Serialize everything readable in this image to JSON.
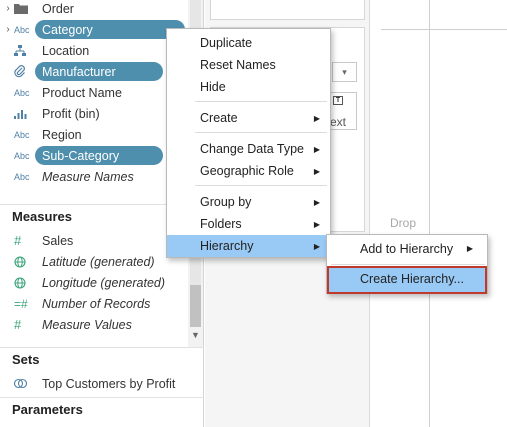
{
  "dimensions": {
    "items": [
      {
        "label": "Order",
        "icon": "folder-icon",
        "chevron": "›",
        "selected": false,
        "italic": false
      },
      {
        "label": "Category",
        "icon": "abc-icon",
        "chevron": "›",
        "selected": true,
        "italic": false
      },
      {
        "label": "Location",
        "icon": "hierarchy-icon",
        "chevron": "",
        "selected": false,
        "italic": false
      },
      {
        "label": "Manufacturer",
        "icon": "paperclip-icon",
        "chevron": "",
        "selected": true,
        "italic": false
      },
      {
        "label": "Product Name",
        "icon": "abc-icon",
        "chevron": "",
        "selected": false,
        "italic": false
      },
      {
        "label": "Profit (bin)",
        "icon": "histogram-icon",
        "chevron": "",
        "selected": false,
        "italic": false
      },
      {
        "label": "Region",
        "icon": "abc-icon",
        "chevron": "",
        "selected": false,
        "italic": false
      },
      {
        "label": "Sub-Category",
        "icon": "abc-icon",
        "chevron": "",
        "selected": true,
        "italic": false
      },
      {
        "label": "Measure Names",
        "icon": "abc-icon",
        "chevron": "",
        "selected": false,
        "italic": true
      }
    ]
  },
  "measures": {
    "title": "Measures",
    "items": [
      {
        "label": "Sales",
        "icon": "hash-icon",
        "italic": false
      },
      {
        "label": "Latitude (generated)",
        "icon": "globe-icon",
        "italic": true
      },
      {
        "label": "Longitude (generated)",
        "icon": "globe-icon",
        "italic": true
      },
      {
        "label": "Number of Records",
        "icon": "hash-equals-icon",
        "italic": true
      },
      {
        "label": "Measure Values",
        "icon": "hash-icon",
        "italic": true
      }
    ]
  },
  "sets": {
    "title": "Sets",
    "items": [
      {
        "label": "Top Customers by Profit",
        "icon": "sets-icon"
      }
    ]
  },
  "parameters": {
    "title": "Parameters"
  },
  "icon_text": {
    "abc": "Abc",
    "text_btn_glyph": "T"
  },
  "shelf": {
    "text_button_label": "ext",
    "dropdown_arrow": "▾"
  },
  "view": {
    "drop_label": "Drop"
  },
  "context_menu": {
    "items": [
      {
        "label": "Duplicate",
        "has_submenu": false
      },
      {
        "label": "Reset Names",
        "has_submenu": false
      },
      {
        "label": "Hide",
        "has_submenu": false
      },
      {
        "label": "Create",
        "has_submenu": true
      },
      {
        "label": "Change Data Type",
        "has_submenu": true
      },
      {
        "label": "Geographic Role",
        "has_submenu": true
      },
      {
        "label": "Group by",
        "has_submenu": true
      },
      {
        "label": "Folders",
        "has_submenu": true
      },
      {
        "label": "Hierarchy",
        "has_submenu": true,
        "active": true
      }
    ],
    "arrow": "▶"
  },
  "hierarchy_submenu": {
    "add_label": "Add to Hierarchy",
    "create_label": "Create Hierarchy...",
    "arrow": "▶"
  },
  "colors": {
    "selected_pill": "#4f8fae",
    "menu_highlight": "#99c9f5",
    "focus_outline": "#c0392b",
    "icon_blue": "#4f81a6"
  }
}
